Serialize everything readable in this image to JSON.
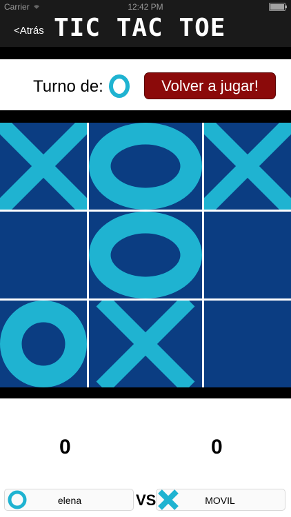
{
  "status_bar": {
    "carrier": "Carrier",
    "time": "12:42 PM"
  },
  "nav": {
    "back_label": "<Atrás",
    "title": "TIC TAC TOE"
  },
  "turn": {
    "label": "Turno de:",
    "current_symbol": "O"
  },
  "replay_button": {
    "label": "Volver a jugar!"
  },
  "board": {
    "cells": [
      "X",
      "O",
      "X",
      "",
      "O",
      "",
      "O",
      "X",
      ""
    ]
  },
  "players": {
    "left": {
      "name": "elena",
      "symbol": "O",
      "score": "0"
    },
    "vs_label": "VS",
    "right": {
      "name": "MOVIL",
      "symbol": "X",
      "score": "0"
    }
  },
  "colors": {
    "board_bg": "#0b3d82",
    "mark": "#1fb3d1",
    "replay_bg": "#8b0a0a",
    "topbar": "#1a1a1a"
  }
}
